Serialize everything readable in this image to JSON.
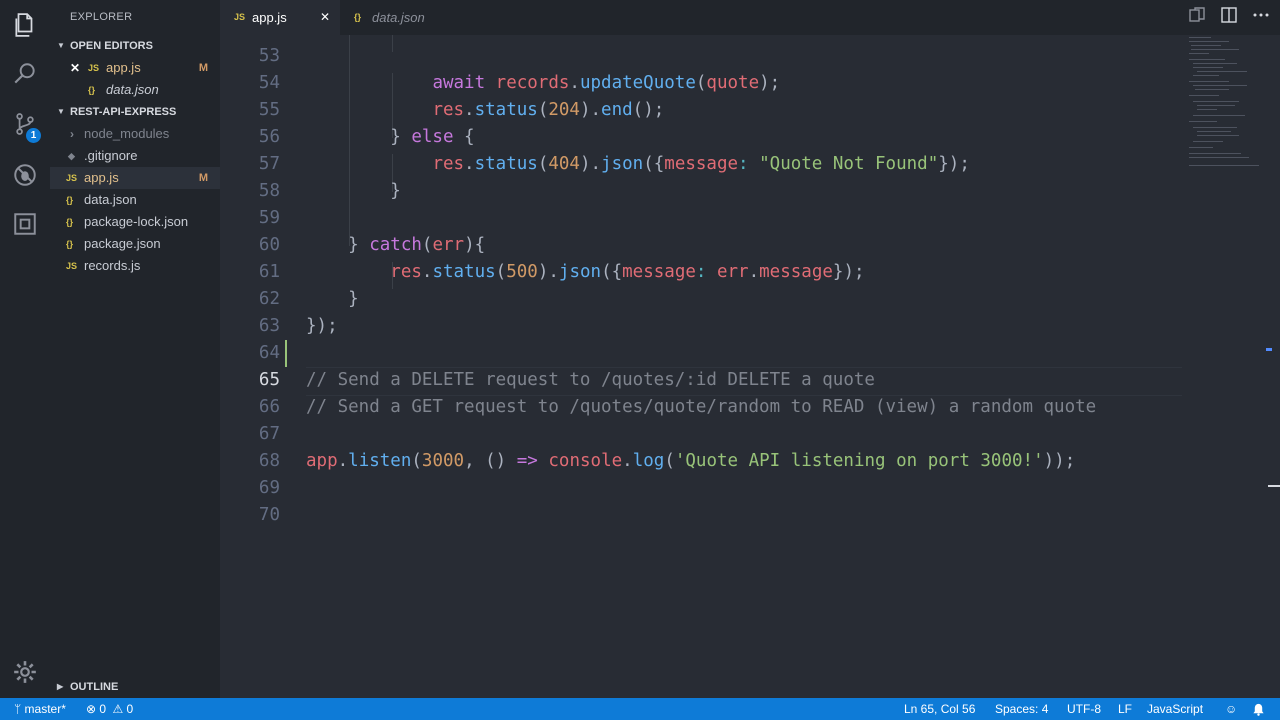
{
  "activity_bar": {
    "icons": [
      "files-icon",
      "search-icon",
      "source-control-icon",
      "debug-icon",
      "extensions-icon",
      "settings-gear-icon"
    ],
    "scm_badge": "1"
  },
  "explorer": {
    "title": "EXPLORER",
    "open_editors_label": "OPEN EDITORS",
    "open_editors": [
      {
        "icon": "JS",
        "name": "app.js",
        "status": "M",
        "close": "✕"
      },
      {
        "icon": "{}",
        "name": "data.json"
      }
    ],
    "folder_label": "REST-API-EXPRESS",
    "files": [
      {
        "icon": "›",
        "name": "node_modules"
      },
      {
        "icon": "◆",
        "name": ".gitignore"
      },
      {
        "icon": "JS",
        "name": "app.js",
        "status": "M"
      },
      {
        "icon": "{}",
        "name": "data.json"
      },
      {
        "icon": "{}",
        "name": "package-lock.json"
      },
      {
        "icon": "{}",
        "name": "package.json"
      },
      {
        "icon": "JS",
        "name": "records.js"
      }
    ],
    "outline_label": "OUTLINE"
  },
  "tabs": [
    {
      "icon": "JS",
      "label": "app.js",
      "close": "✕",
      "active": true
    },
    {
      "icon": "{}",
      "label": "data.json",
      "active": false
    }
  ],
  "editor": {
    "current_line": 65,
    "lines": [
      {
        "num": "53",
        "tokens": []
      },
      {
        "num": "54",
        "tokens": [
          [
            "p",
            "            "
          ],
          [
            "k",
            "await "
          ],
          [
            "v",
            "records"
          ],
          [
            "p",
            "."
          ],
          [
            "f",
            "updateQuote"
          ],
          [
            "p",
            "("
          ],
          [
            "v",
            "quote"
          ],
          [
            "p",
            ");"
          ]
        ]
      },
      {
        "num": "55",
        "tokens": [
          [
            "p",
            "            "
          ],
          [
            "v",
            "res"
          ],
          [
            "p",
            "."
          ],
          [
            "f",
            "status"
          ],
          [
            "p",
            "("
          ],
          [
            "n",
            "204"
          ],
          [
            "p",
            ")."
          ],
          [
            "f",
            "end"
          ],
          [
            "p",
            "();"
          ]
        ]
      },
      {
        "num": "56",
        "tokens": [
          [
            "p",
            "        } "
          ],
          [
            "k",
            "else"
          ],
          [
            "p",
            " {"
          ]
        ]
      },
      {
        "num": "57",
        "tokens": [
          [
            "p",
            "            "
          ],
          [
            "v",
            "res"
          ],
          [
            "p",
            "."
          ],
          [
            "f",
            "status"
          ],
          [
            "p",
            "("
          ],
          [
            "n",
            "404"
          ],
          [
            "p",
            ")."
          ],
          [
            "f",
            "json"
          ],
          [
            "p",
            "({"
          ],
          [
            "pr",
            "message"
          ],
          [
            "o",
            ": "
          ],
          [
            "s",
            "\"Quote Not Found\""
          ],
          [
            "p",
            "});"
          ]
        ]
      },
      {
        "num": "58",
        "tokens": [
          [
            "p",
            "        }"
          ]
        ]
      },
      {
        "num": "59",
        "tokens": []
      },
      {
        "num": "60",
        "tokens": [
          [
            "p",
            "    } "
          ],
          [
            "k",
            "catch"
          ],
          [
            "p",
            "("
          ],
          [
            "v",
            "err"
          ],
          [
            "p",
            "){"
          ]
        ]
      },
      {
        "num": "61",
        "tokens": [
          [
            "p",
            "        "
          ],
          [
            "v",
            "res"
          ],
          [
            "p",
            "."
          ],
          [
            "f",
            "status"
          ],
          [
            "p",
            "("
          ],
          [
            "n",
            "500"
          ],
          [
            "p",
            ")."
          ],
          [
            "f",
            "json"
          ],
          [
            "p",
            "({"
          ],
          [
            "pr",
            "message"
          ],
          [
            "o",
            ": "
          ],
          [
            "v",
            "err"
          ],
          [
            "p",
            "."
          ],
          [
            "v",
            "message"
          ],
          [
            "p",
            "});"
          ]
        ]
      },
      {
        "num": "62",
        "tokens": [
          [
            "p",
            "    }"
          ]
        ]
      },
      {
        "num": "63",
        "tokens": [
          [
            "p",
            "});"
          ]
        ]
      },
      {
        "num": "64",
        "tokens": []
      },
      {
        "num": "65",
        "tokens": [
          [
            "c",
            "// Send a DELETE request to /quotes/:id DELETE a quote"
          ]
        ]
      },
      {
        "num": "66",
        "tokens": [
          [
            "c",
            "// Send a GET request to /quotes/quote/random to READ (view) a random quote"
          ]
        ]
      },
      {
        "num": "67",
        "tokens": []
      },
      {
        "num": "68",
        "tokens": [
          [
            "v",
            "app"
          ],
          [
            "p",
            "."
          ],
          [
            "f",
            "listen"
          ],
          [
            "p",
            "("
          ],
          [
            "n",
            "3000"
          ],
          [
            "p",
            ", () "
          ],
          [
            "k",
            "=>"
          ],
          [
            "p",
            " "
          ],
          [
            "v",
            "console"
          ],
          [
            "p",
            "."
          ],
          [
            "f",
            "log"
          ],
          [
            "p",
            "("
          ],
          [
            "s",
            "'Quote API listening on port 3000!'"
          ],
          [
            "p",
            "));"
          ]
        ]
      },
      {
        "num": "69",
        "tokens": []
      },
      {
        "num": "70",
        "tokens": []
      }
    ]
  },
  "status_bar": {
    "branch": "master*",
    "errors": "0",
    "warnings": "0",
    "position": "Ln 65, Col 56",
    "spaces": "Spaces: 4",
    "encoding": "UTF-8",
    "eol": "LF",
    "language": "JavaScript"
  }
}
